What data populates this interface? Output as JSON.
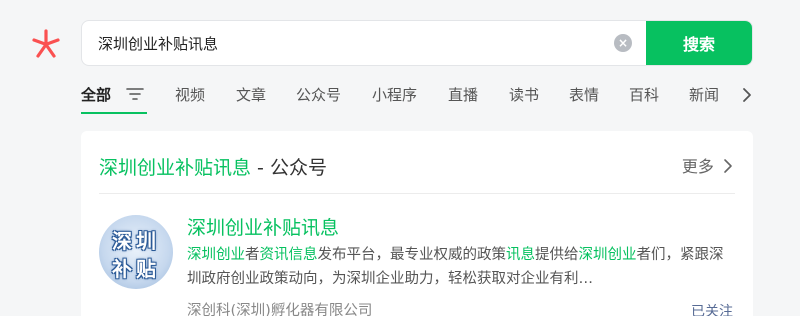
{
  "search": {
    "query": "深圳创业补贴讯息",
    "button_label": "搜索",
    "clear_icon": "clear-icon"
  },
  "tabs": [
    {
      "label": "全部",
      "active": true
    },
    {
      "label": "视频"
    },
    {
      "label": "文章"
    },
    {
      "label": "公众号"
    },
    {
      "label": "小程序"
    },
    {
      "label": "直播"
    },
    {
      "label": "读书"
    },
    {
      "label": "表情"
    },
    {
      "label": "百科"
    },
    {
      "label": "新闻"
    }
  ],
  "section": {
    "title_highlight": "深圳创业补贴讯息",
    "title_suffix": " - 公众号",
    "more_label": "更多"
  },
  "account": {
    "name": "深圳创业补贴讯息",
    "avatar_text_line1": "深圳",
    "avatar_text_line2": "补贴",
    "desc_parts": [
      {
        "text": "深圳创业",
        "hl": true
      },
      {
        "text": "者",
        "hl": false
      },
      {
        "text": "资讯信息",
        "hl": true
      },
      {
        "text": "发布平台，最专业权威的政策",
        "hl": false
      },
      {
        "text": "讯息",
        "hl": true
      },
      {
        "text": "提供给",
        "hl": false
      },
      {
        "text": "深圳创业",
        "hl": true
      },
      {
        "text": "者们，紧跟深圳政府创业政策动向，为深圳企业助力，轻松获取对企业有利…",
        "hl": false
      }
    ],
    "org": "深创科(深圳)孵化器有限公司",
    "follow_status": "已关注"
  },
  "colors": {
    "accent": "#07c160",
    "link": "#576b95",
    "background": "#f5f6f7"
  }
}
